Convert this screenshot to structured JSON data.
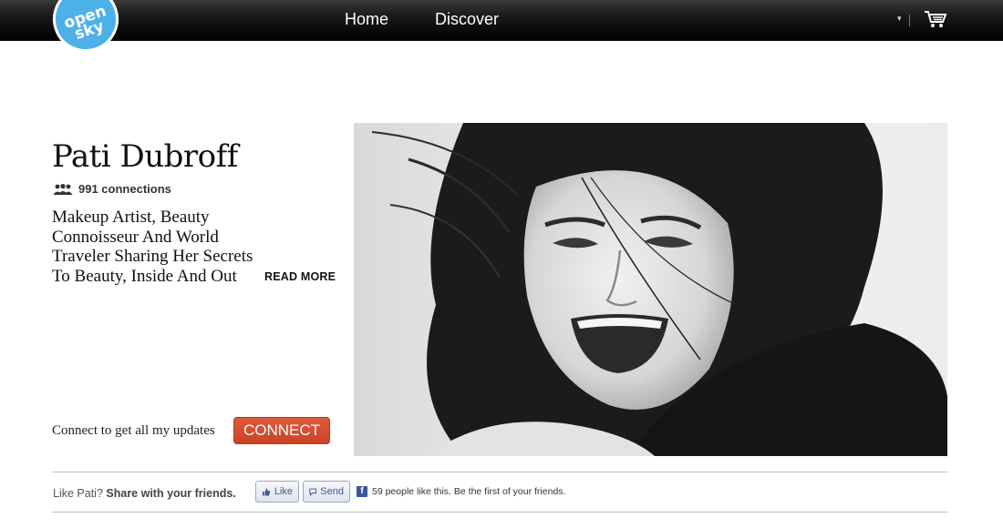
{
  "header": {
    "logo_line1": "open",
    "logo_line2": "sky",
    "nav": {
      "home": "Home",
      "discover": "Discover"
    },
    "dropdown_glyph": "▾",
    "icons": [
      "cart-icon",
      "chevron-down-icon"
    ]
  },
  "profile": {
    "name": "Pati Dubroff",
    "connections": "991 connections",
    "bio": "Makeup Artist, Beauty Connoisseur And World Traveler Sharing Her Secrets To Beauty, Inside And Out",
    "read_more": "READ MORE",
    "connect_prompt": "Connect to get all my updates",
    "connect_button": "CONNECT"
  },
  "share": {
    "prompt": "Like Pati?",
    "prompt_bold": "Share with your friends.",
    "like_button": "Like",
    "send_button": "Send",
    "fb_glyph": "f",
    "fb_status": "59 people like this. Be the first of your friends."
  },
  "colors": {
    "accent": "#d24e31",
    "logo_blue": "#4db0e8",
    "facebook": "#3b5998",
    "topbar": "#111111"
  }
}
